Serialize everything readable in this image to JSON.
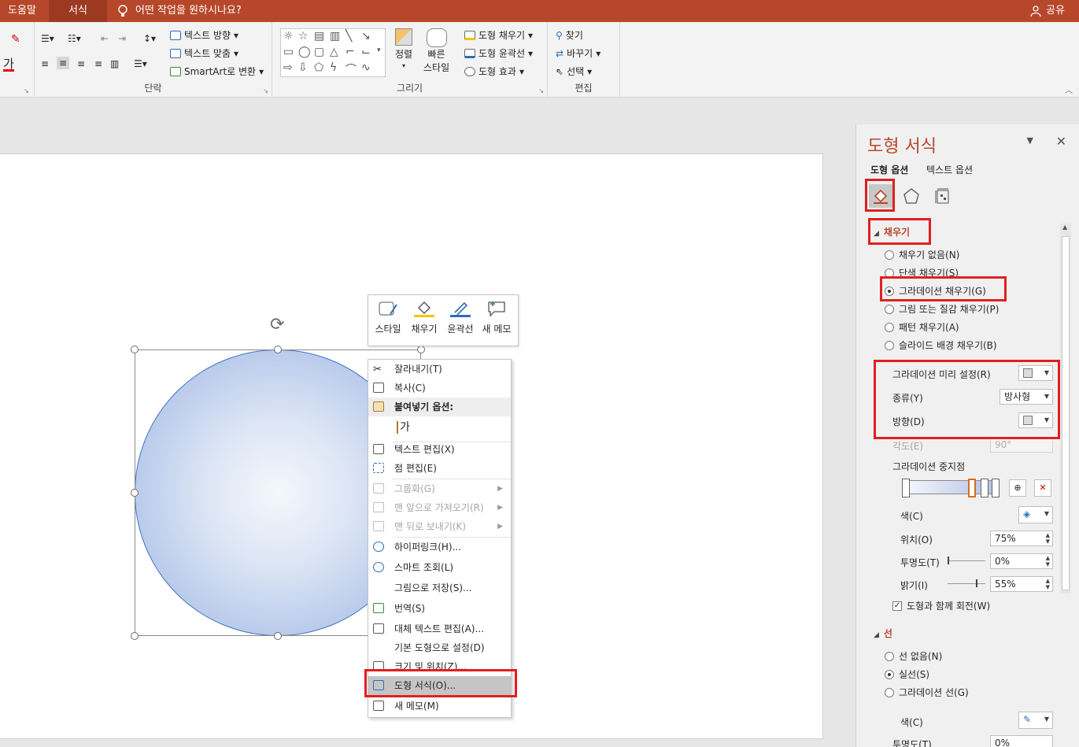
{
  "topbar": {
    "tabs": [
      "도움말",
      "서식"
    ],
    "tell_me": "어떤 작업을 원하시나요?",
    "share": "공유"
  },
  "ribbon": {
    "paragraph_group": "단락",
    "draw_group": "그리기",
    "edit_group": "편집",
    "text_direction": "텍스트 방향",
    "align_text": "텍스트 맞춤",
    "smartart": "SmartArt로 변환",
    "arrange": "정렬",
    "quick_styles_1": "빠른",
    "quick_styles_2": "스타일",
    "shape_fill": "도형 채우기",
    "shape_outline": "도형 윤곽선",
    "shape_effects": "도형 효과",
    "find": "찾기",
    "replace": "바꾸기",
    "select": "선택",
    "font_color_glyph": "가"
  },
  "mini_toolbar": {
    "style": "스타일",
    "fill": "채우기",
    "outline": "윤곽선",
    "new_comment": "새 메모"
  },
  "context_menu": {
    "cut": "잘라내기(T)",
    "copy": "복사(C)",
    "paste_options": "붙여넣기 옵션:",
    "paste_glyph": "가",
    "edit_text": "텍스트 편집(X)",
    "edit_points": "점 편집(E)",
    "group": "그룹화(G)",
    "bring_front": "맨 앞으로 가져오기(R)",
    "send_back": "맨 뒤로 보내기(K)",
    "hyperlink": "하이퍼링크(H)...",
    "smart_lookup": "스마트 조회(L)",
    "save_as_picture": "그림으로 저장(S)...",
    "translate": "번역(S)",
    "edit_alt_text": "대체 텍스트 편집(A)...",
    "set_default_shape": "기본 도형으로 설정(D)",
    "size_position": "크기 및 위치(Z)...",
    "format_shape": "도형 서식(O)...",
    "new_comment": "새 메모(M)"
  },
  "pane": {
    "title": "도형 서식",
    "tab_shape": "도형 옵션",
    "tab_text": "텍스트 옵션",
    "fill_section": "채우기",
    "fill_options": [
      "채우기 없음(N)",
      "단색 채우기(S)",
      "그라데이션 채우기(G)",
      "그림 또는 질감 채우기(P)",
      "패턴 채우기(A)",
      "슬라이드 배경 채우기(B)"
    ],
    "fill_selected_index": 2,
    "preset_label": "그라데이션 미리 설정(R)",
    "type_label": "종류(Y)",
    "type_value": "방사형",
    "direction_label": "방향(D)",
    "angle_label": "각도(E)",
    "angle_value": "90°",
    "stops_label": "그라데이션 중지점",
    "color_label": "색(C)",
    "position_label": "위치(O)",
    "position_value": "75%",
    "transparency_label": "투명도(T)",
    "transparency_value": "0%",
    "brightness_label": "밝기(I)",
    "brightness_value": "55%",
    "rotate_with_shape": "도형과 함께 회전(W)",
    "line_section": "선",
    "line_options": [
      "선 없음(N)",
      "실선(S)",
      "그라데이션 선(G)"
    ],
    "line_selected_index": 1,
    "line_color_label": "색(C)",
    "line_transparency_label": "투명도(T)",
    "line_transparency_value": "0%"
  },
  "colors": {
    "accent": "#b7472a",
    "highlight_box": "#e02020",
    "shape_border": "#4472c4"
  }
}
